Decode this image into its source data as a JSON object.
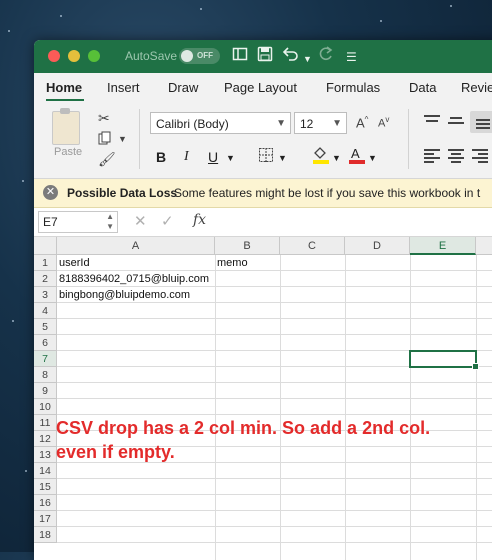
{
  "titlebar": {
    "autosave_label": "AutoSave",
    "autosave_state": "OFF"
  },
  "ribbon_tabs": [
    "Home",
    "Insert",
    "Draw",
    "Page Layout",
    "Formulas",
    "Data",
    "Revie"
  ],
  "ribbon": {
    "paste_label": "Paste",
    "font_name": "Calibri (Body)",
    "font_size": "12",
    "bold": "B",
    "italic": "I",
    "underline": "U",
    "font_color_letter": "A"
  },
  "infobar": {
    "title": "Possible Data Loss",
    "message": "Some features might be lost if you save this workbook in t"
  },
  "formula_bar": {
    "name_box": "E7",
    "fx": "fx",
    "content": ""
  },
  "grid": {
    "columns": [
      "A",
      "B",
      "C",
      "D",
      "E"
    ],
    "selected_column": "E",
    "rows": [
      "1",
      "2",
      "3",
      "4",
      "5",
      "6",
      "7",
      "8",
      "9",
      "10",
      "11",
      "12",
      "13",
      "14",
      "15",
      "16",
      "17",
      "18"
    ],
    "selected_row": "7",
    "cells": {
      "A1": "userId",
      "B1": "memo",
      "A2": "8188396402_0715@bluip.com",
      "A3": "bingbong@bluipdemo.com"
    }
  },
  "annotation": "CSV drop has a 2 col min. So add a 2nd col. even if empty.",
  "colors": {
    "excel_green": "#1f7145",
    "annotation_red": "#e32b2b",
    "infobar_bg": "#fcf4d2"
  },
  "icons": [
    "close-icon",
    "minimize-icon",
    "zoom-icon",
    "toggle-icon",
    "save-icon",
    "undo-icon",
    "redo-icon",
    "customize-icon",
    "cut-icon",
    "copy-icon",
    "format-painter-icon",
    "increase-font-icon",
    "decrease-font-icon",
    "border-icon",
    "fill-color-icon",
    "font-color-icon",
    "align-icon",
    "x-circle-icon",
    "cancel-icon",
    "enter-icon",
    "function-icon"
  ]
}
